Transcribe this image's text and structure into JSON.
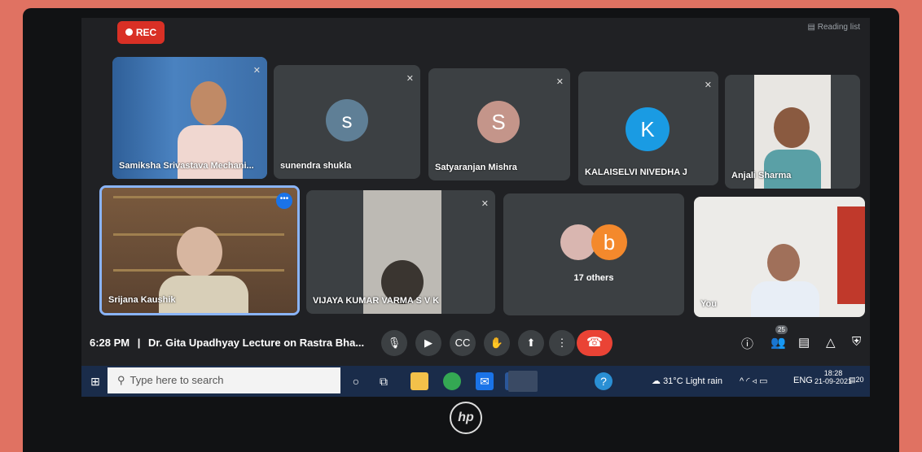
{
  "browser": {
    "reading_list": "Reading list"
  },
  "recording": {
    "label": "REC"
  },
  "participants": [
    {
      "name": "Samiksha Srivastava Mechani..."
    },
    {
      "name": "sunendra shukla",
      "initial": "s"
    },
    {
      "name": "Satyaranjan Mishra",
      "initial": "S"
    },
    {
      "name": "KALAISELVI NIVEDHA J",
      "initial": "K"
    },
    {
      "name": "Anjali Sharma"
    },
    {
      "name": "Srijana Kaushik"
    },
    {
      "name": "VIJAYA KUMAR VARMA S V K"
    },
    {
      "name": "You"
    }
  ],
  "others": {
    "label": "17 others",
    "initial": "b"
  },
  "meeting": {
    "time": "6:28 PM",
    "separator": "|",
    "title": "Dr. Gita Upadhyay Lecture on Rastra Bha..."
  },
  "controls": {
    "people_count": "25"
  },
  "taskbar": {
    "search_placeholder": "Type here to search",
    "weather": "31°C",
    "weather_text": "Light rain",
    "language": "ENG",
    "time": "18:28",
    "date": "21-09-2021",
    "notifications": "20"
  },
  "laptop": {
    "brand": "hp"
  },
  "colors": {
    "accent_red": "#ea4335",
    "tile_bg": "#3c4043",
    "active_border": "#8ab4f8"
  }
}
